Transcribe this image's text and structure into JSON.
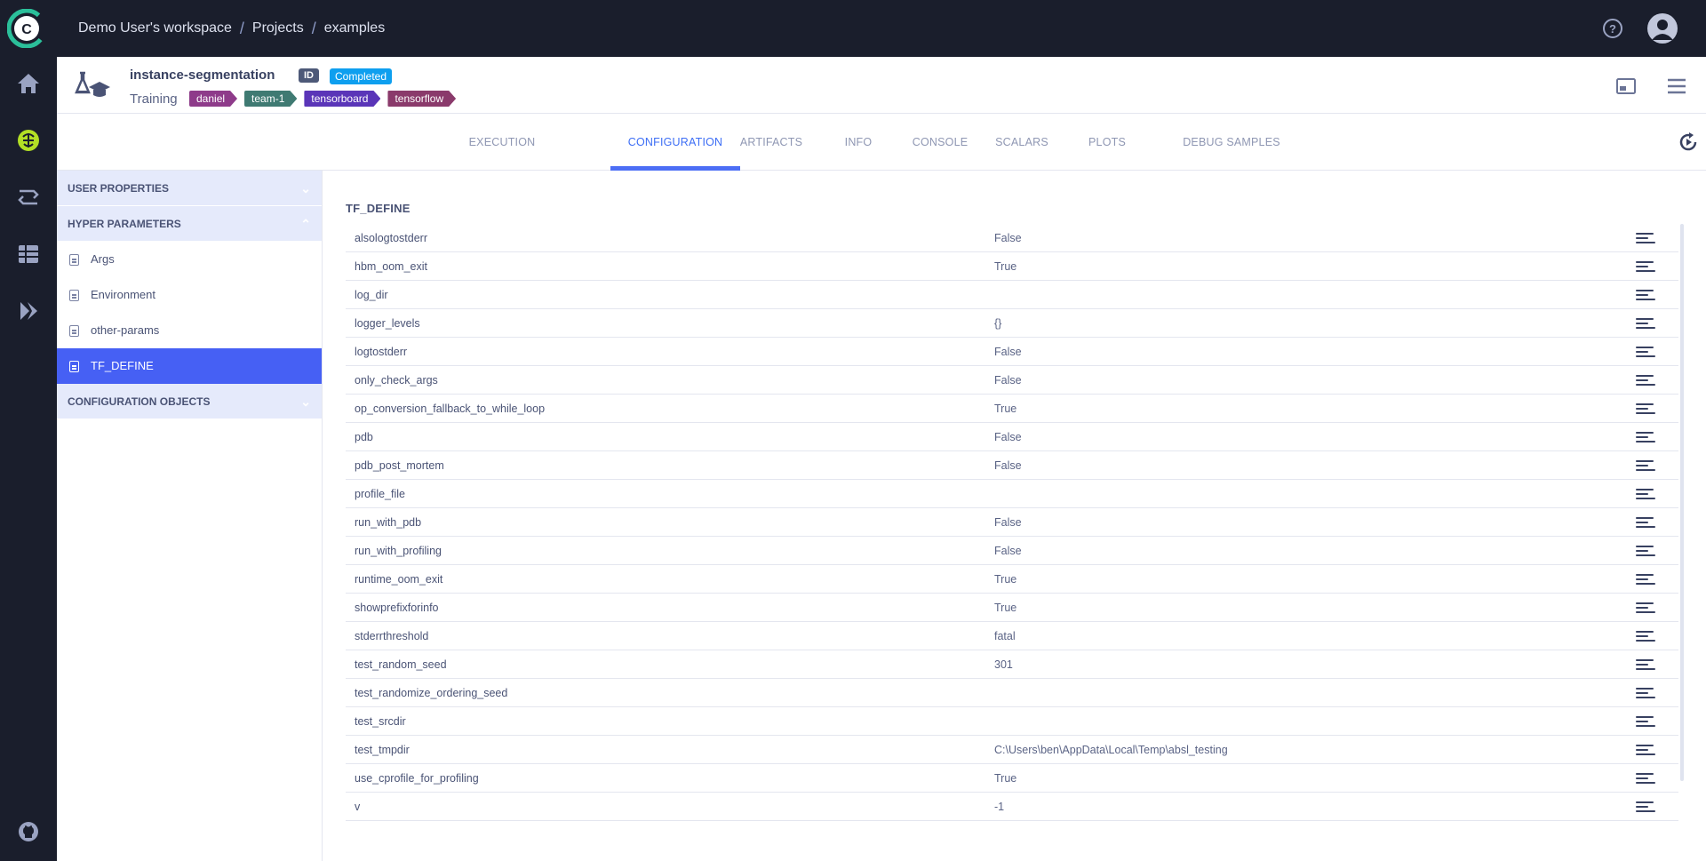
{
  "breadcrumb": {
    "workspace": "Demo User's workspace",
    "projects": "Projects",
    "current": "examples"
  },
  "header": {
    "experiment_name": "instance-segmentation",
    "id_badge": "ID",
    "status": "Completed",
    "type": "Training",
    "tags": [
      {
        "label": "daniel",
        "color": "#8e3b8a"
      },
      {
        "label": "team-1",
        "color": "#3f7a72"
      },
      {
        "label": "tensorboard",
        "color": "#5a35b8"
      },
      {
        "label": "tensorflow",
        "color": "#8a3a6b"
      }
    ]
  },
  "tabs": [
    {
      "label": "EXECUTION",
      "active": false
    },
    {
      "label": "CONFIGURATION",
      "active": true
    },
    {
      "label": "ARTIFACTS",
      "active": false
    },
    {
      "label": "INFO",
      "active": false
    },
    {
      "label": "CONSOLE",
      "active": false
    },
    {
      "label": "SCALARS",
      "active": false
    },
    {
      "label": "PLOTS",
      "active": false
    },
    {
      "label": "DEBUG SAMPLES",
      "active": false
    }
  ],
  "left_panel": {
    "user_properties": "USER PROPERTIES",
    "hyper_parameters": "HYPER PARAMETERS",
    "items": [
      "Args",
      "Environment",
      "other-params",
      "TF_DEFINE"
    ],
    "configuration_objects": "CONFIGURATION OBJECTS"
  },
  "section_title": "TF_DEFINE",
  "params": [
    {
      "key": "alsologtostderr",
      "value": "False"
    },
    {
      "key": "hbm_oom_exit",
      "value": "True"
    },
    {
      "key": "log_dir",
      "value": ""
    },
    {
      "key": "logger_levels",
      "value": "{}"
    },
    {
      "key": "logtostderr",
      "value": "False"
    },
    {
      "key": "only_check_args",
      "value": "False"
    },
    {
      "key": "op_conversion_fallback_to_while_loop",
      "value": "True"
    },
    {
      "key": "pdb",
      "value": "False"
    },
    {
      "key": "pdb_post_mortem",
      "value": "False"
    },
    {
      "key": "profile_file",
      "value": ""
    },
    {
      "key": "run_with_pdb",
      "value": "False"
    },
    {
      "key": "run_with_profiling",
      "value": "False"
    },
    {
      "key": "runtime_oom_exit",
      "value": "True"
    },
    {
      "key": "showprefixforinfo",
      "value": "True"
    },
    {
      "key": "stderrthreshold",
      "value": "fatal"
    },
    {
      "key": "test_random_seed",
      "value": "301"
    },
    {
      "key": "test_randomize_ordering_seed",
      "value": ""
    },
    {
      "key": "test_srcdir",
      "value": ""
    },
    {
      "key": "test_tmpdir",
      "value": "C:\\Users\\ben\\AppData\\Local\\Temp\\absl_testing"
    },
    {
      "key": "use_cprofile_for_profiling",
      "value": "True"
    },
    {
      "key": "v",
      "value": "-1"
    }
  ],
  "colors": {
    "accent": "#4660f4",
    "sidebar_bg": "#1a1e2c",
    "status_completed": "#0e9fef",
    "active_nav_icon": "#b3e025"
  },
  "icons": {
    "nav": [
      "home-icon",
      "experiments-brain-icon",
      "pipelines-icon",
      "datasets-icon",
      "deploy-icon"
    ],
    "bottom": "github-icon"
  }
}
